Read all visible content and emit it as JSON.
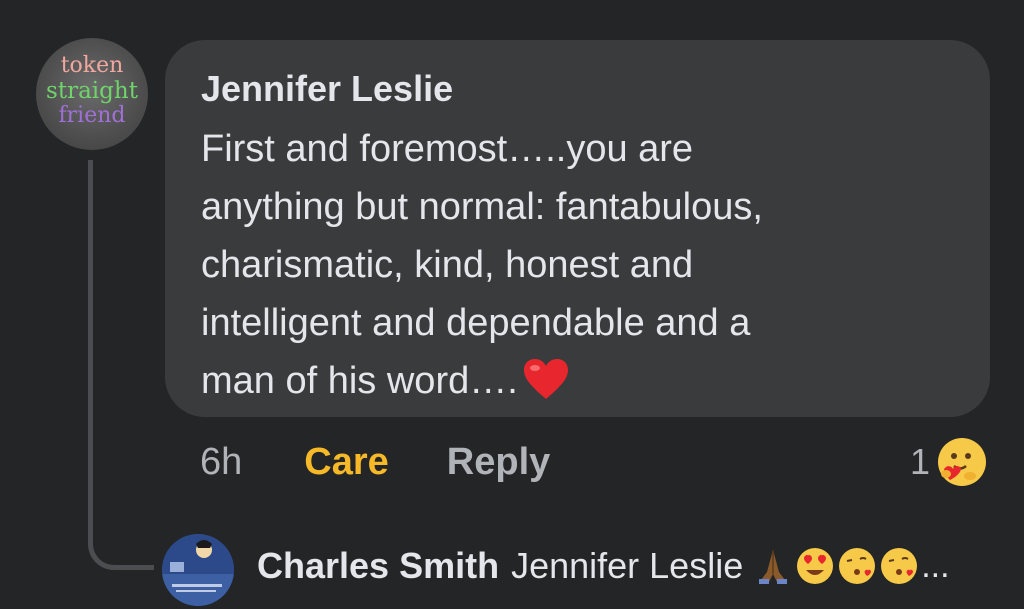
{
  "avatar": {
    "line1": "token",
    "line2": "straight",
    "line3": "friend"
  },
  "comment": {
    "author": "Jennifer Leslie",
    "text": "First and foremost…..you are\nanything but normal: fantabulous,\ncharismatic, kind, honest and\nintelligent and dependable and a\nman of his word….",
    "emoji": "heart-emoji"
  },
  "actions": {
    "time": "6h",
    "care_label": "Care",
    "reply_label": "Reply",
    "reaction_count": "1",
    "reaction_emoji": "care-emoji"
  },
  "reply": {
    "author": "Charles Smith",
    "mention": "Jennifer Leslie",
    "emojis": [
      "folded-hands-emoji",
      "heart-eyes-emoji",
      "blowing-kiss-emoji",
      "blowing-kiss-emoji"
    ],
    "truncation": "..."
  },
  "colors": {
    "background": "#242526",
    "bubble": "#3a3b3c",
    "care_accent": "#f7b928",
    "secondary_text": "#b0b3b8"
  }
}
